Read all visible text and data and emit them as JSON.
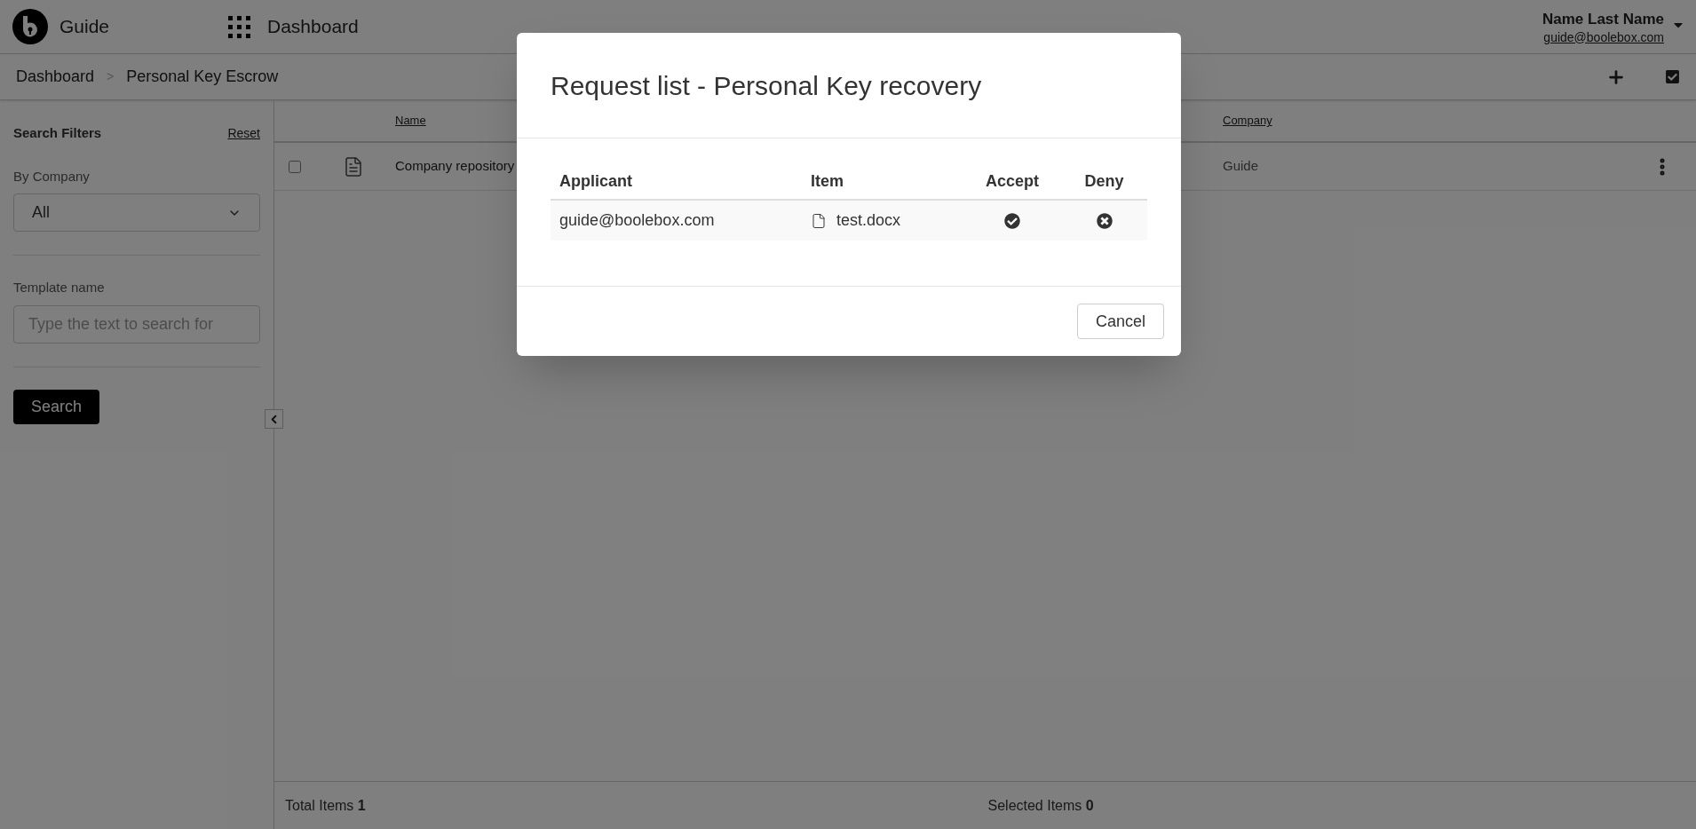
{
  "header": {
    "app_name": "Guide",
    "section": "Dashboard",
    "user_name": "Name Last Name",
    "user_email": "guide@boolebox.com"
  },
  "breadcrumb": [
    {
      "label": "Dashboard"
    },
    {
      "label": "Personal Key Escrow"
    }
  ],
  "breadcrumb_separator": ">",
  "sidebar": {
    "title": "Search Filters",
    "reset": "Reset",
    "filters": [
      {
        "kind": "select",
        "label": "By Company",
        "value": "All"
      },
      {
        "kind": "text",
        "label": "Template name",
        "placeholder": "Type the text to search for"
      }
    ],
    "search_button": "Search"
  },
  "table": {
    "columns": [
      "Name",
      "Company"
    ],
    "rows": [
      {
        "checked": false,
        "name": "Company repository",
        "company": "Guide"
      }
    ]
  },
  "footer": {
    "total_label": "Total Items",
    "total": "1",
    "selected_label": "Selected Items",
    "selected": "0"
  },
  "modal": {
    "title": "Request list - Personal Key recovery",
    "columns": [
      "Applicant",
      "Item",
      "Accept",
      "Deny"
    ],
    "rows": [
      {
        "applicant": "guide@boolebox.com",
        "item": "test.docx"
      }
    ],
    "cancel": "Cancel"
  }
}
